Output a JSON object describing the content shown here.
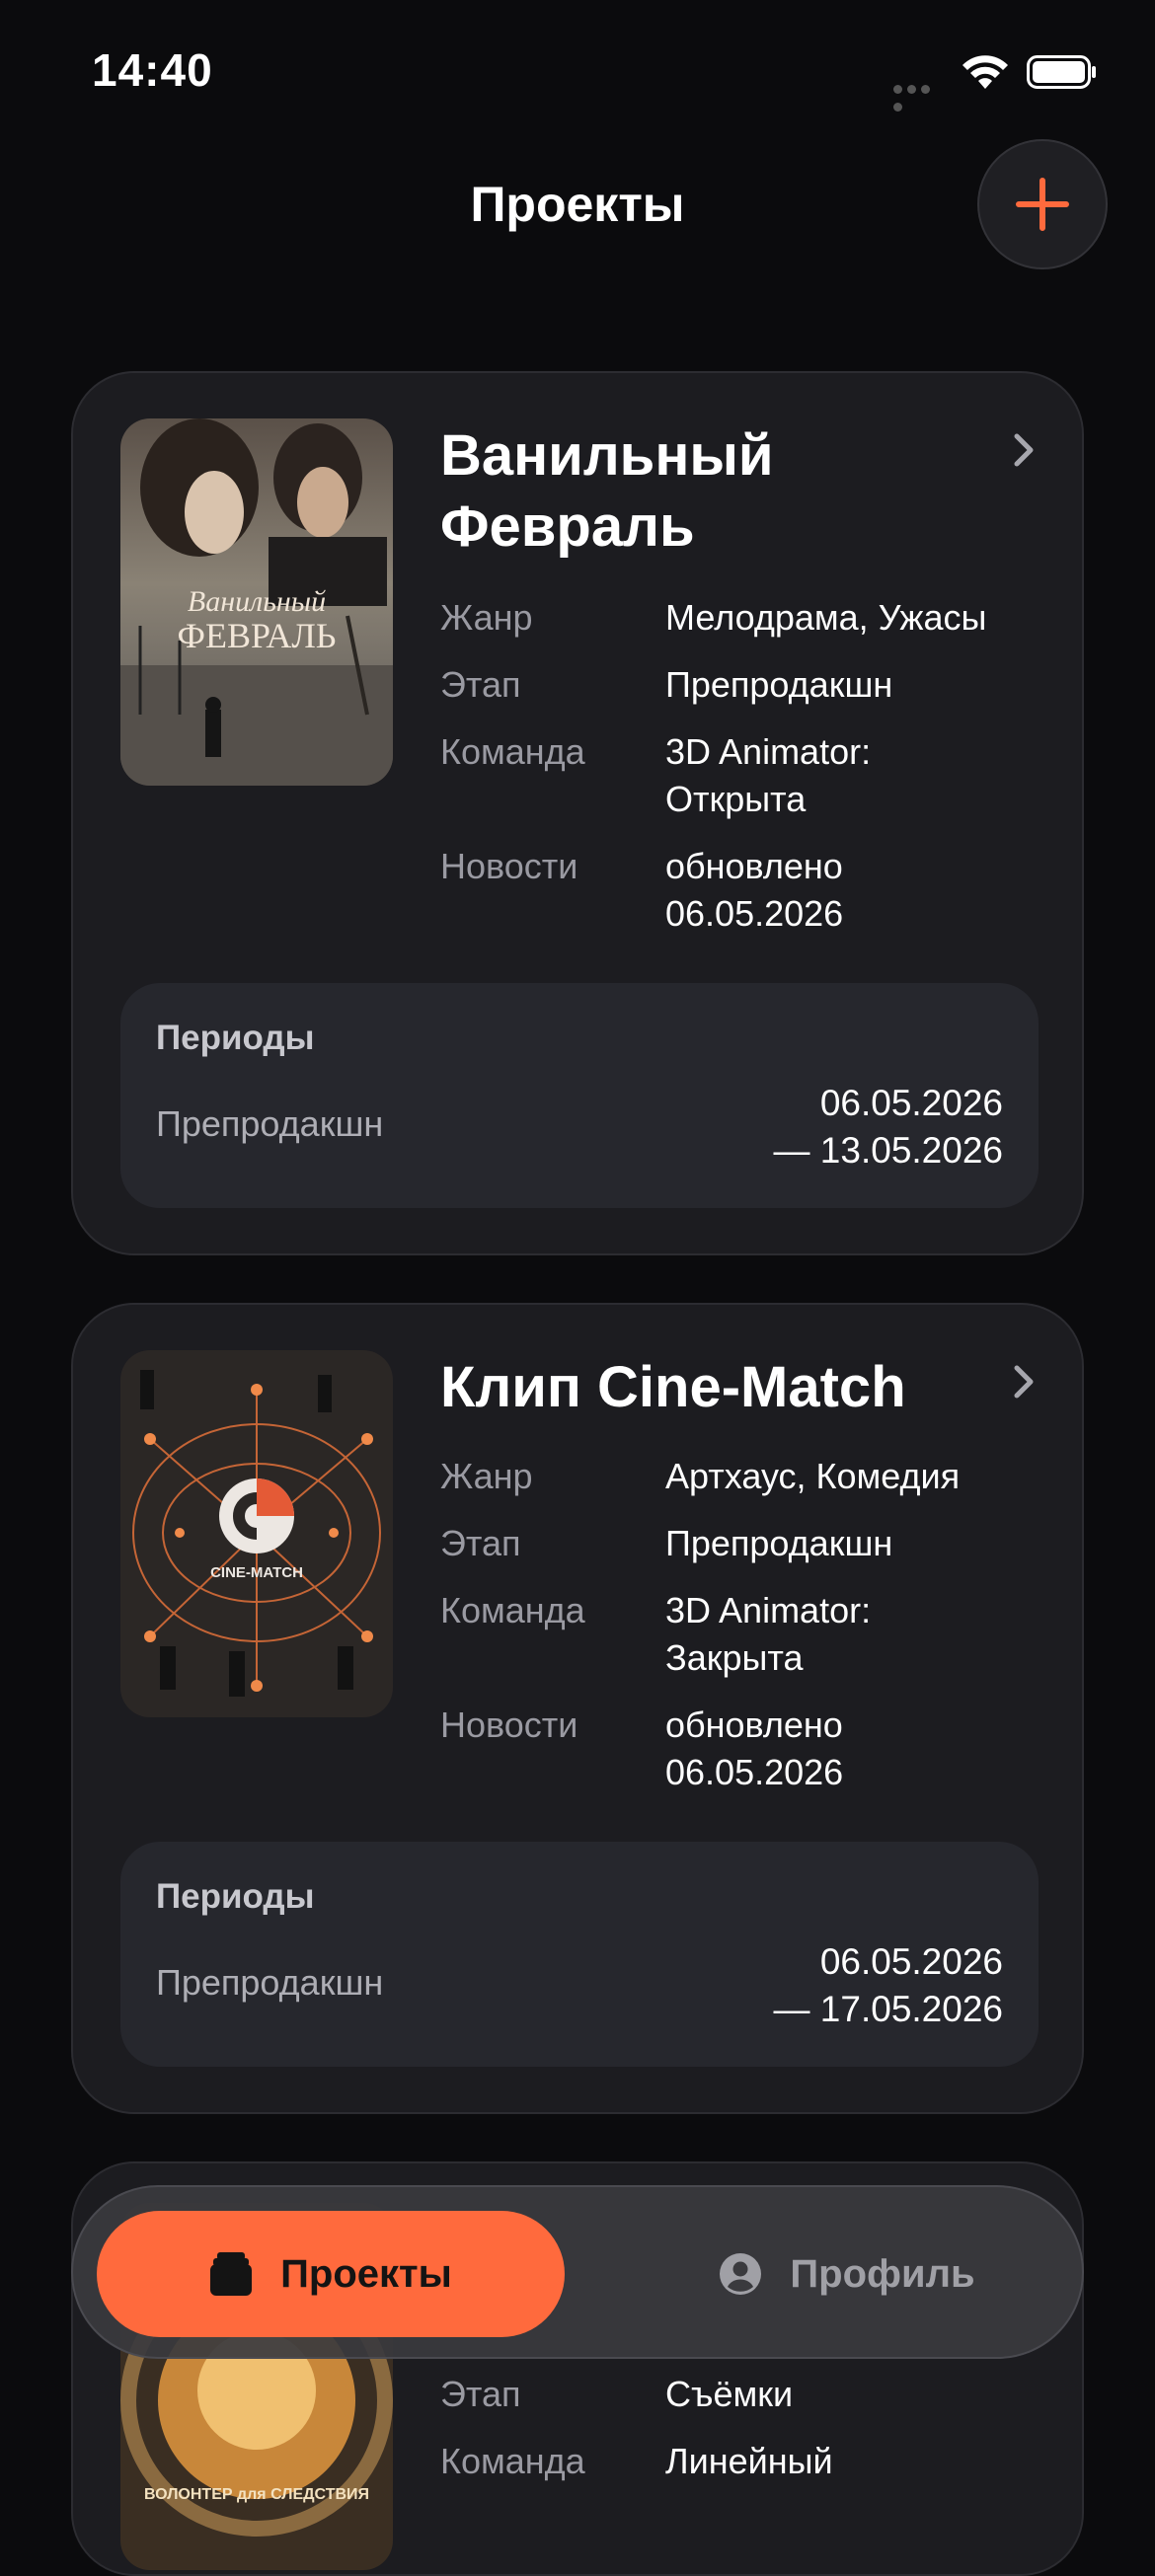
{
  "status_bar": {
    "time": "14:40"
  },
  "header": {
    "title": "Проекты"
  },
  "projects": [
    {
      "title": "Ванильный Февраль",
      "poster_text": [
        "Ванильный",
        "ФЕВРАЛЬ"
      ],
      "genre_label": "Жанр",
      "genre": "Мелодрама, Ужасы",
      "stage_label": "Этап",
      "stage": "Препродакшн",
      "team_label": "Команда",
      "team": "3D Animator: Открыта",
      "news_label": "Новости",
      "news": "обновлено 06.05.2026",
      "periods_title": "Периоды",
      "period_name": "Препродакшн",
      "period_start": "06.05.2026",
      "period_end": "— 13.05.2026"
    },
    {
      "title": "Клип Cine-Match",
      "poster_text": [
        "CINE-MATCH"
      ],
      "genre_label": "Жанр",
      "genre": "Артхаус, Комедия",
      "stage_label": "Этап",
      "stage": "Препродакшн",
      "team_label": "Команда",
      "team": "3D Animator: Закрыта",
      "news_label": "Новости",
      "news": "обновлено 06.05.2026",
      "periods_title": "Периоды",
      "period_name": "Препродакшн",
      "period_start": "06.05.2026",
      "period_end": "— 17.05.2026"
    },
    {
      "poster_text": [
        "ВОЛОНТЕР для СЛЕДСТВИЯ"
      ],
      "stage_label": "Этап",
      "stage": "Съёмки",
      "team_label": "Команда",
      "team": "Линейный"
    }
  ],
  "tabbar": {
    "tabs": [
      {
        "label": "Проекты",
        "active": true
      },
      {
        "label": "Профиль",
        "active": false
      }
    ]
  },
  "colors": {
    "accent": "#ff6a3d",
    "background": "#0b0b0d",
    "card": "#1c1c20"
  }
}
